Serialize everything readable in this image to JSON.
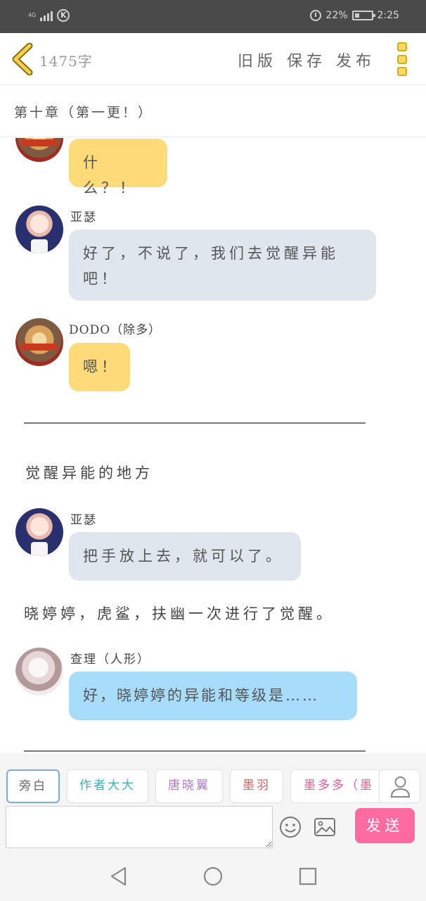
{
  "status_bar": {
    "network": "4G",
    "battery_percent": "22%",
    "time": "2:25"
  },
  "toolbar": {
    "word_count": "1475字",
    "old_version_label": "旧版",
    "save_label": "保存",
    "publish_label": "发布"
  },
  "chapter": {
    "title": "第十章（第一更！）"
  },
  "messages": [
    {
      "type": "bubble",
      "speaker": "",
      "text": "什么？！",
      "color": "#fedb78"
    },
    {
      "type": "bubble",
      "speaker": "亚瑟",
      "text_line1": "好了，不说了，我们去觉醒异能",
      "text_line2": "吧！",
      "color": "#e0e6ee"
    },
    {
      "type": "bubble",
      "speaker": "DODO（除多）",
      "text": "嗯！",
      "color": "#fedb78"
    },
    {
      "type": "divider"
    },
    {
      "type": "narration",
      "text": "觉醒异能的地方"
    },
    {
      "type": "bubble",
      "speaker": "亚瑟",
      "text": "把手放上去，就可以了。",
      "color": "#e0e6ee"
    },
    {
      "type": "narration",
      "text": "晓婷婷，虎鲨，扶幽一次进行了觉醒。"
    },
    {
      "type": "bubble",
      "speaker": "查理（人形）",
      "text": "好，晓婷婷的异能和等级是……",
      "color": "#a8dcfb"
    },
    {
      "type": "divider"
    }
  ],
  "roles": [
    {
      "label": "旁白",
      "color": "#666666"
    },
    {
      "label": "作者大大",
      "color": "#3fb0b0"
    },
    {
      "label": "唐晓翼",
      "color": "#b07acc"
    },
    {
      "label": "墨羽",
      "color": "#e06060"
    },
    {
      "label": "墨多多（墨",
      "color": "#e0609a"
    }
  ],
  "input": {
    "value": "",
    "send_label": "发送"
  }
}
